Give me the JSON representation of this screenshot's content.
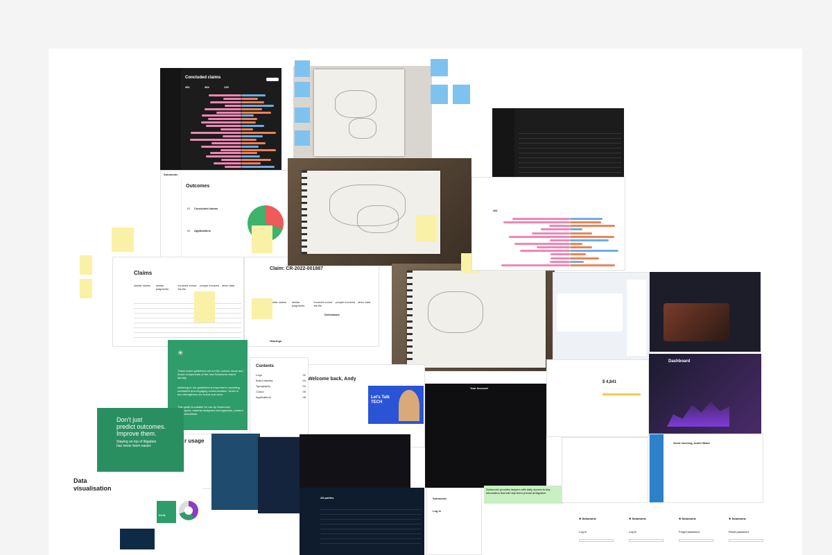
{
  "claims_dashboard": {
    "title": "Concluded claims",
    "stat_1": "491",
    "stat_2": "384",
    "stat_3": "129"
  },
  "outcomes": {
    "brand": "Solomonic",
    "title": "Outcomes",
    "card_1": "Concluded claims",
    "card_2": "Applications",
    "num_1": "01",
    "num_2": "02"
  },
  "claims_list": {
    "title": "Claims",
    "cols": [
      "similar claims",
      "similar judgments",
      "involved on/out the file",
      "people involved",
      "other data"
    ]
  },
  "claim_detail": {
    "title": "Claim: CR-2022-001887",
    "tabs": [
      "similar claims",
      "similar judgments",
      "involved on/out the file",
      "people involved",
      "other data"
    ],
    "section": "Defendants",
    "hearings": "Hearings"
  },
  "brand_green": {
    "text_1": "These brand guidelines set out the various visual and brand components of the new Solomonic brand identity.",
    "text_2": "Adhering to our guidelines is important in providing consistent and engaging communication, which in turn strengthens our brand and voice.",
    "text_3": "This guide is suitable for use by Solomonic employees, external designers and agencies, printers and consultants."
  },
  "contents": {
    "title": "Contents",
    "items": [
      {
        "label": "Logo",
        "page": "02"
      },
      {
        "label": "Brand identity",
        "page": "03"
      },
      {
        "label": "Typography",
        "page": "04"
      },
      {
        "label": "Colour",
        "page": "05"
      },
      {
        "label": "Applications",
        "page": "06"
      }
    ]
  },
  "welcome": {
    "title": "Welcome back, Andy",
    "video_title": "Let's Talk TECH"
  },
  "banner": {
    "line_1": "Don't just",
    "line_2": "predict outcomes.",
    "line_3": "Improve them.",
    "line_4": "Staying on top of litigation",
    "line_5": "has never been easier."
  },
  "usage": {
    "title": "r usage"
  },
  "dataviz": {
    "title_1": "Data",
    "title_2": "visualisation",
    "value": "£4.0L"
  },
  "all_parties": {
    "title": "All parties",
    "login_brand": "Solomonic",
    "login_title": "Log in"
  },
  "logins": {
    "brand": "Solomonic",
    "titles": [
      "Log in",
      "Log in",
      "Forgot password",
      "Reset password"
    ]
  },
  "dashboard_purple": {
    "title": "Dashboard"
  },
  "settings": {
    "title": "Your Account"
  },
  "amount": {
    "value": "$ 4,841"
  },
  "welcome_back": {
    "title": "Good morning, Andre Blake"
  },
  "green_note": {
    "text": "Solomonic provides lawyers with daily access to key information that will help them prevail at litigation."
  },
  "colors": {
    "pink": "#ef86b4",
    "blue": "#6aaee9",
    "orange": "#ef8255",
    "green": "#2f9d6a"
  }
}
